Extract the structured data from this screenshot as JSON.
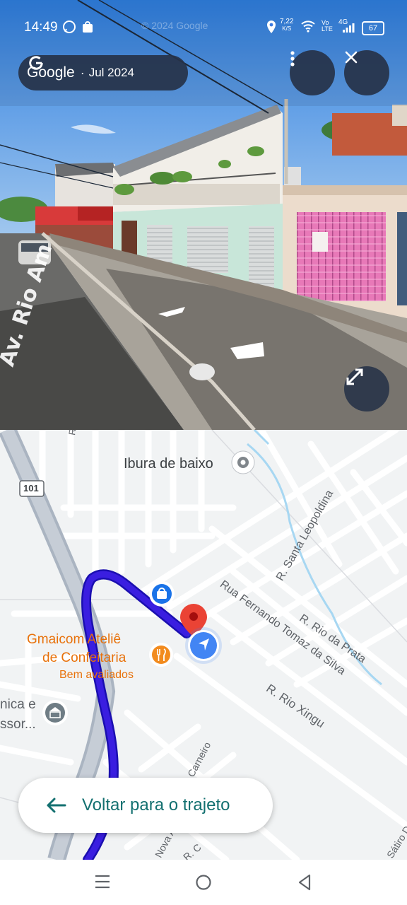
{
  "status_bar": {
    "time": "14:49",
    "net_speed": "7,22",
    "net_speed_unit": "K/S",
    "volte": "Vo LTE",
    "network": "4G",
    "battery": "67",
    "watermark": "© 2024 Google"
  },
  "streetview": {
    "provider": "Google",
    "date": "Jul 2024",
    "separator": "·",
    "road_text": "Av. Rio Amazonas"
  },
  "map": {
    "labels": {
      "neighborhood": "Ibura de baixo",
      "highway_shield": "101",
      "place_name_line1": "Gmaicom Ateliê",
      "place_name_line2": "de Confeitaria",
      "place_subtitle": "Bem avaliados",
      "partial_place_line1": "nica e",
      "partial_place_line2": "ssor...",
      "street_santa_leopoldina": "R. Santa Leopoldina",
      "street_fernando_tomaz": "Rua Fernando Tomaz da Silva",
      "street_rio_prata": "R. Rio da Prata",
      "street_rio_xingu": "R. Rio Xingu",
      "street_carneiro": "Carneiro",
      "street_nova": "Nova A",
      "street_rc": "R. C",
      "street_satiro": "Sátiro D",
      "street_r_top": "R"
    }
  },
  "back_button": {
    "label": "Voltar para o trajeto"
  },
  "colors": {
    "route": "#3a1ee0",
    "accent_teal": "#137070",
    "pin_red": "#ea4335",
    "nav_blue": "#4285f4",
    "place_orange": "#e8710a"
  }
}
